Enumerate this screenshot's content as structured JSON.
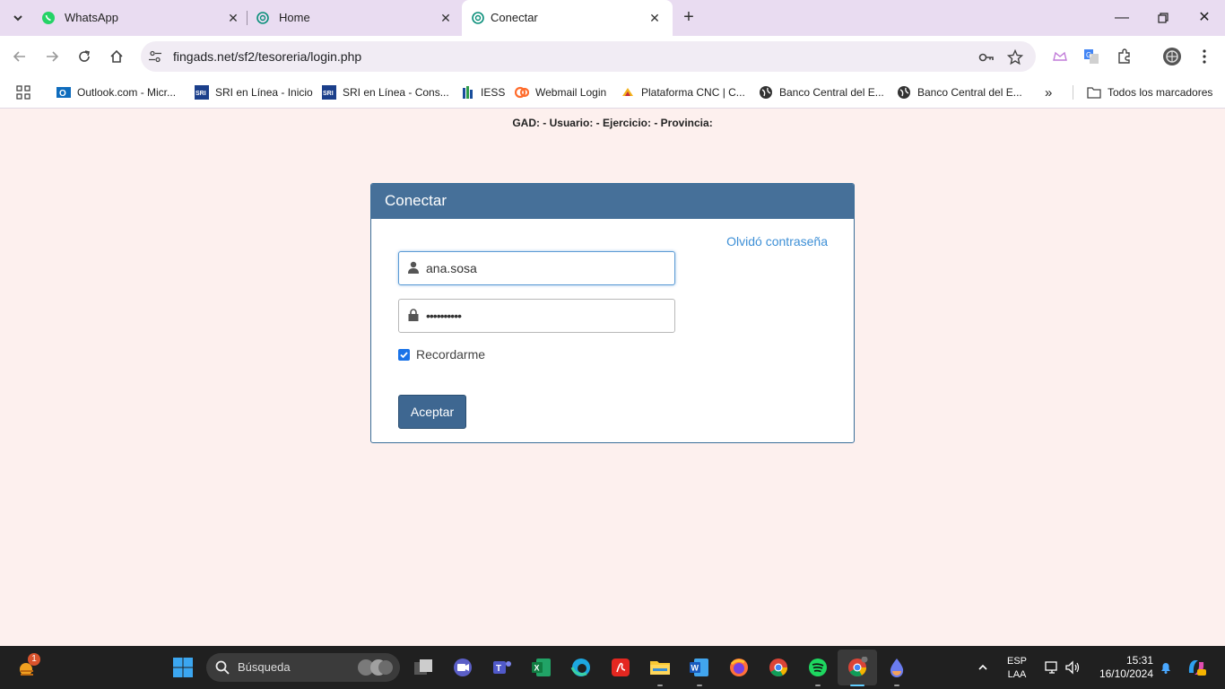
{
  "tabs": [
    {
      "title": "WhatsApp",
      "icon": "whatsapp-icon"
    },
    {
      "title": "Home",
      "icon": "openai-icon"
    },
    {
      "title": "Conectar",
      "icon": "openai-icon",
      "active": true
    }
  ],
  "address_bar": {
    "url": "fingads.net/sf2/tesoreria/login.php"
  },
  "bookmarks": [
    {
      "label": "Outlook.com - Micr...",
      "icon": "outlook-icon"
    },
    {
      "label": "SRI en Línea - Inicio",
      "icon": "sri-icon"
    },
    {
      "label": "SRI en Línea - Cons...",
      "icon": "sri-icon"
    },
    {
      "label": "IESS",
      "icon": "iess-icon"
    },
    {
      "label": "Webmail Login",
      "icon": "cpanel-icon"
    },
    {
      "label": "Plataforma CNC | C...",
      "icon": "cnc-icon"
    },
    {
      "label": "Banco Central del E...",
      "icon": "globe-icon"
    },
    {
      "label": "Banco Central del E...",
      "icon": "globe-icon"
    }
  ],
  "bookmarks_all": "Todos los marcadores",
  "page": {
    "status_line": "GAD: - Usuario: - Ejercicio: - Provincia:",
    "panel_title": "Conectar",
    "forgot_link": "Olvidó contraseña",
    "username": "ana.sosa",
    "password_mask": "••••••••••",
    "remember_label": "Recordarme",
    "remember_checked": true,
    "submit_label": "Aceptar"
  },
  "taskbar": {
    "search_placeholder": "Búsqueda",
    "weather_badge": "1",
    "lang_top": "ESP",
    "lang_bottom": "LAA",
    "time": "15:31",
    "date": "16/10/2024"
  }
}
